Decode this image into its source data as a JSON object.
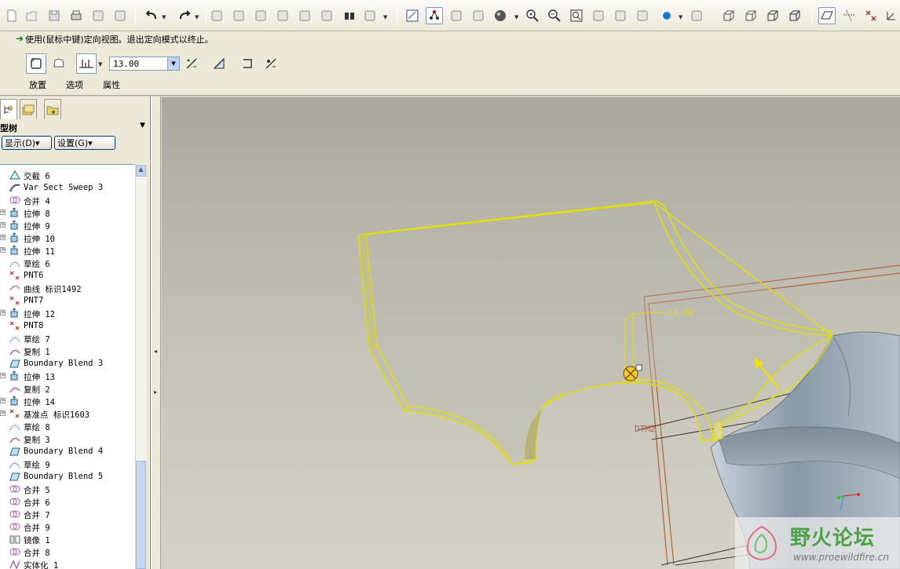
{
  "toolbar": {
    "icons": [
      "new-file-icon",
      "open-icon",
      "save-icon",
      "print-icon",
      "send-icon",
      "mail-icon",
      "undo-icon",
      "redo-icon",
      "cut-icon",
      "copy-icon",
      "paste-icon",
      "paste-special-icon",
      "regenerate-icon",
      "regenerate-manager-icon",
      "find-icon",
      "select-box-icon",
      "sketch-view-icon",
      "sketch-references-icon",
      "palette-icon",
      "3d-view-icon",
      "shading-icon",
      "zoom-in-icon",
      "zoom-out-icon",
      "refit-icon",
      "reorient-icon",
      "view-manager-icon",
      "layers-icon",
      "appearance-icon",
      "model-tree-camera-icon",
      "wireframe-icon",
      "hidden-line-icon",
      "no-hidden-icon",
      "shaded-icon",
      "datum-planes-icon",
      "datum-axes-icon",
      "datum-points-icon",
      "coordinate-systems-icon"
    ]
  },
  "message": {
    "text": "使用(鼠标中键)定向视图。退出定向模式以终止。"
  },
  "dashboard": {
    "labels": [
      "放置",
      "选项",
      "属性"
    ],
    "depth_value": "13.00"
  },
  "left_panel": {
    "title": "型树",
    "show_button": "显示(D)▾",
    "settings_button": "设置(G)▾",
    "tree_items": [
      {
        "label": "交截 6",
        "icon": "intersect-icon",
        "exp": false
      },
      {
        "label": "Var Sect Sweep 3",
        "icon": "sweep-icon",
        "exp": false
      },
      {
        "label": "合并 4",
        "icon": "merge-icon",
        "exp": false
      },
      {
        "label": "拉伸 8",
        "icon": "extrude-icon",
        "exp": true
      },
      {
        "label": "拉伸 9",
        "icon": "extrude-icon",
        "exp": true
      },
      {
        "label": "拉伸 10",
        "icon": "extrude-icon",
        "exp": true
      },
      {
        "label": "拉伸 11",
        "icon": "extrude-icon",
        "exp": true
      },
      {
        "label": "草绘 6",
        "icon": "sketch-icon",
        "exp": false
      },
      {
        "label": "PNT6",
        "icon": "datum-point-icon",
        "exp": false
      },
      {
        "label": "曲线 标识1492",
        "icon": "curve-icon",
        "exp": false
      },
      {
        "label": "PNT7",
        "icon": "datum-point-icon",
        "exp": false
      },
      {
        "label": "拉伸 12",
        "icon": "extrude-icon",
        "exp": true
      },
      {
        "label": "PNT8",
        "icon": "datum-point-icon",
        "exp": false
      },
      {
        "label": "草绘 7",
        "icon": "sketch-icon",
        "exp": false
      },
      {
        "label": "复制 1",
        "icon": "copy-icon",
        "exp": false
      },
      {
        "label": "Boundary Blend 3",
        "icon": "boundary-blend-icon",
        "exp": false
      },
      {
        "label": "拉伸 13",
        "icon": "extrude-icon",
        "exp": true
      },
      {
        "label": "复制 2",
        "icon": "copy-icon",
        "exp": false
      },
      {
        "label": "拉伸 14",
        "icon": "extrude-icon",
        "exp": true
      },
      {
        "label": "基准点 标识1603",
        "icon": "datum-point-icon",
        "exp": true
      },
      {
        "label": "草绘 8",
        "icon": "sketch-icon",
        "exp": false
      },
      {
        "label": "复制 3",
        "icon": "copy-icon",
        "exp": false
      },
      {
        "label": "Boundary Blend 4",
        "icon": "boundary-blend-icon",
        "exp": false
      },
      {
        "label": "草绘 9",
        "icon": "sketch-icon",
        "exp": false
      },
      {
        "label": "Boundary Blend 5",
        "icon": "boundary-blend-icon",
        "exp": false
      },
      {
        "label": "合并 5",
        "icon": "merge-icon",
        "exp": false
      },
      {
        "label": "合并 6",
        "icon": "merge-icon",
        "exp": false
      },
      {
        "label": "合并 7",
        "icon": "merge-icon",
        "exp": false
      },
      {
        "label": "合并 9",
        "icon": "merge-icon",
        "exp": false
      },
      {
        "label": "镜像 1",
        "icon": "mirror-icon",
        "exp": false
      },
      {
        "label": "合并 8",
        "icon": "merge-icon",
        "exp": false
      },
      {
        "label": "实体化 1",
        "icon": "solidify-icon",
        "exp": false
      }
    ]
  },
  "viewport": {
    "dimension_label": "13.00",
    "datum_label": "DTM2",
    "watermark_brand": "野火论坛",
    "watermark_url": "www.proewildfire.cn"
  },
  "colors": {
    "highlight": "#e8e800",
    "datum": "#b0623a",
    "surface": "#9aa8b4"
  }
}
